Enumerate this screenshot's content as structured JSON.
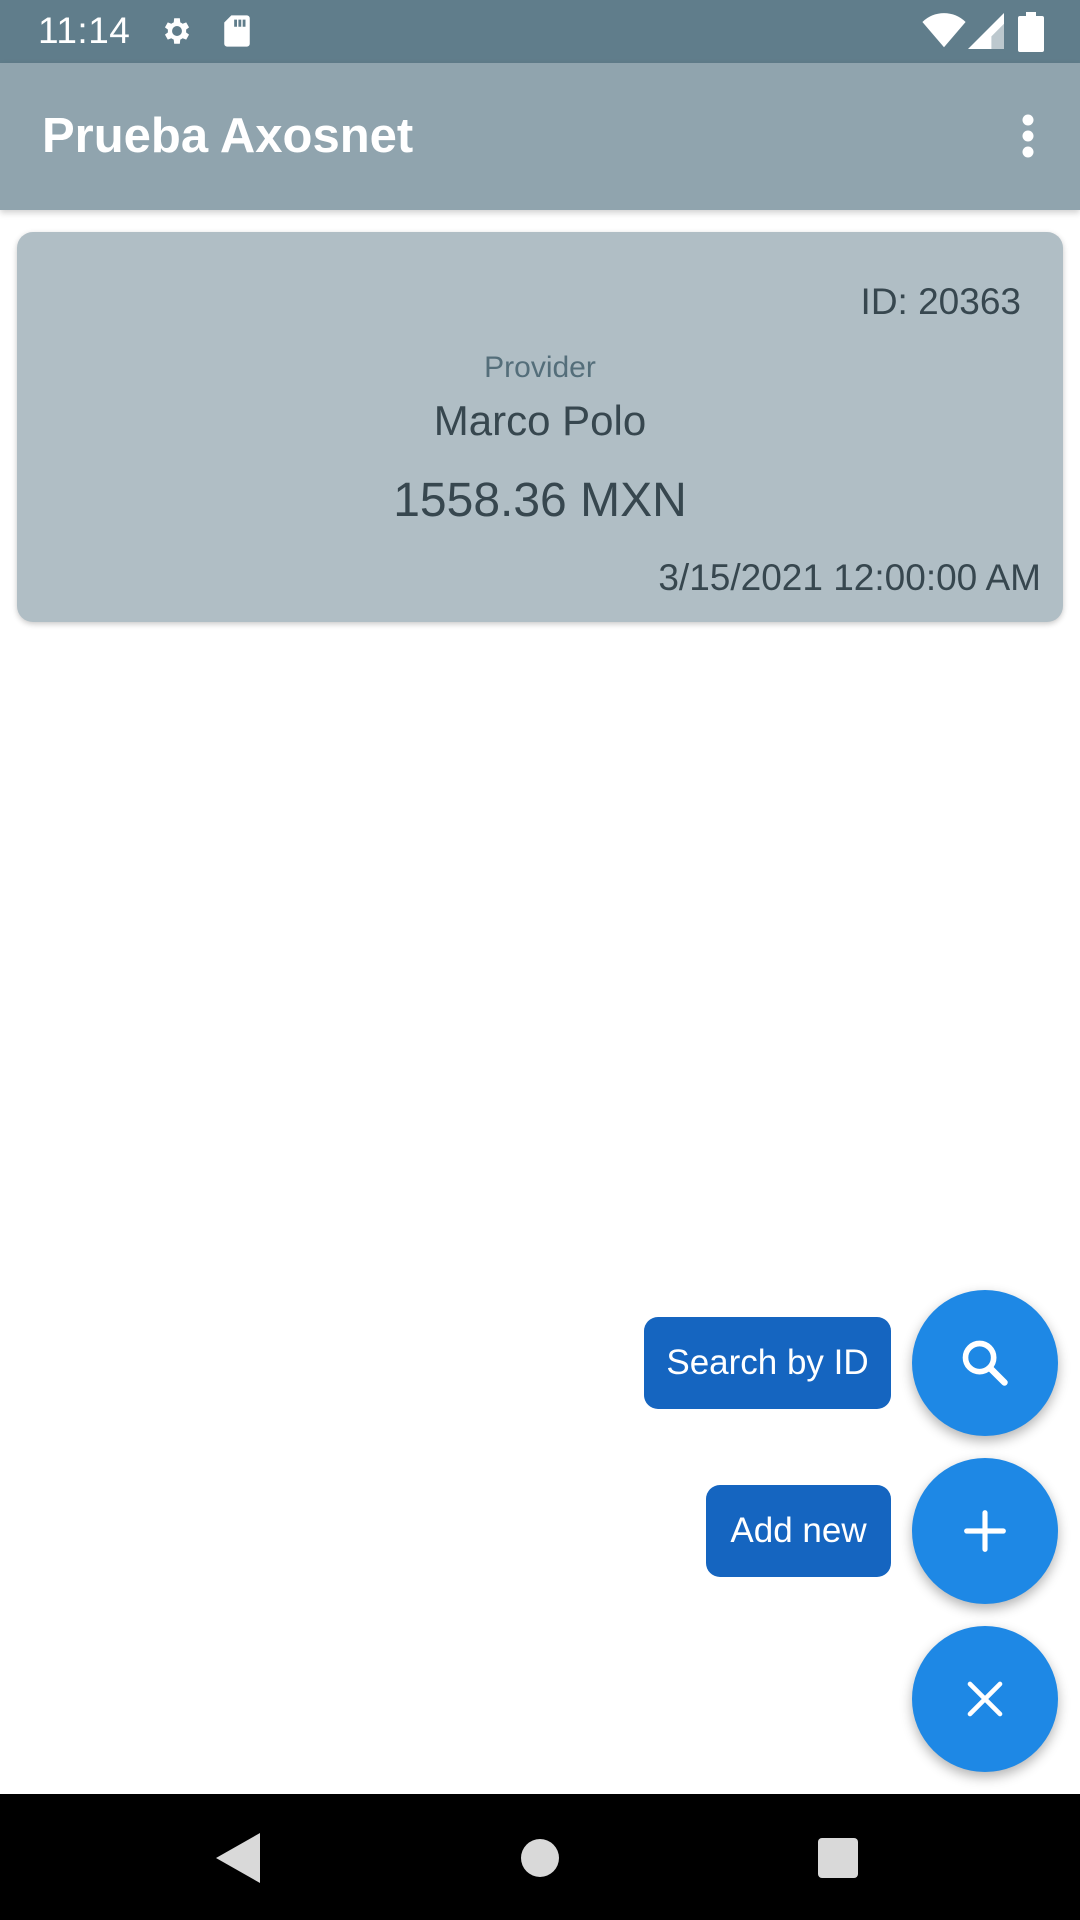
{
  "status_bar": {
    "time": "11:14",
    "icons": [
      "settings-icon",
      "sd-card-icon",
      "wifi-icon",
      "cell-signal-icon",
      "battery-icon"
    ]
  },
  "app_bar": {
    "title": "Prueba Axosnet",
    "menu_icon": "more-vert-icon"
  },
  "receipts": [
    {
      "id_text": "ID: 20363",
      "provider_label": "Provider",
      "provider_name": "Marco Polo",
      "amount": "1558.36 MXN",
      "date": "3/15/2021 12:00:00 AM"
    }
  ],
  "fab_menu": {
    "search_label": "Search by ID",
    "add_label": "Add new",
    "search_icon": "search-icon",
    "add_icon": "plus-icon",
    "close_icon": "close-icon"
  },
  "nav_bar": {
    "icons": [
      "back-icon",
      "home-icon",
      "recents-icon"
    ]
  },
  "colors": {
    "status_bar": "#607d8b",
    "app_bar": "#90a4ae",
    "card": "#b0bec5",
    "fab": "#1e88e5",
    "fab_label": "#1565c0"
  }
}
